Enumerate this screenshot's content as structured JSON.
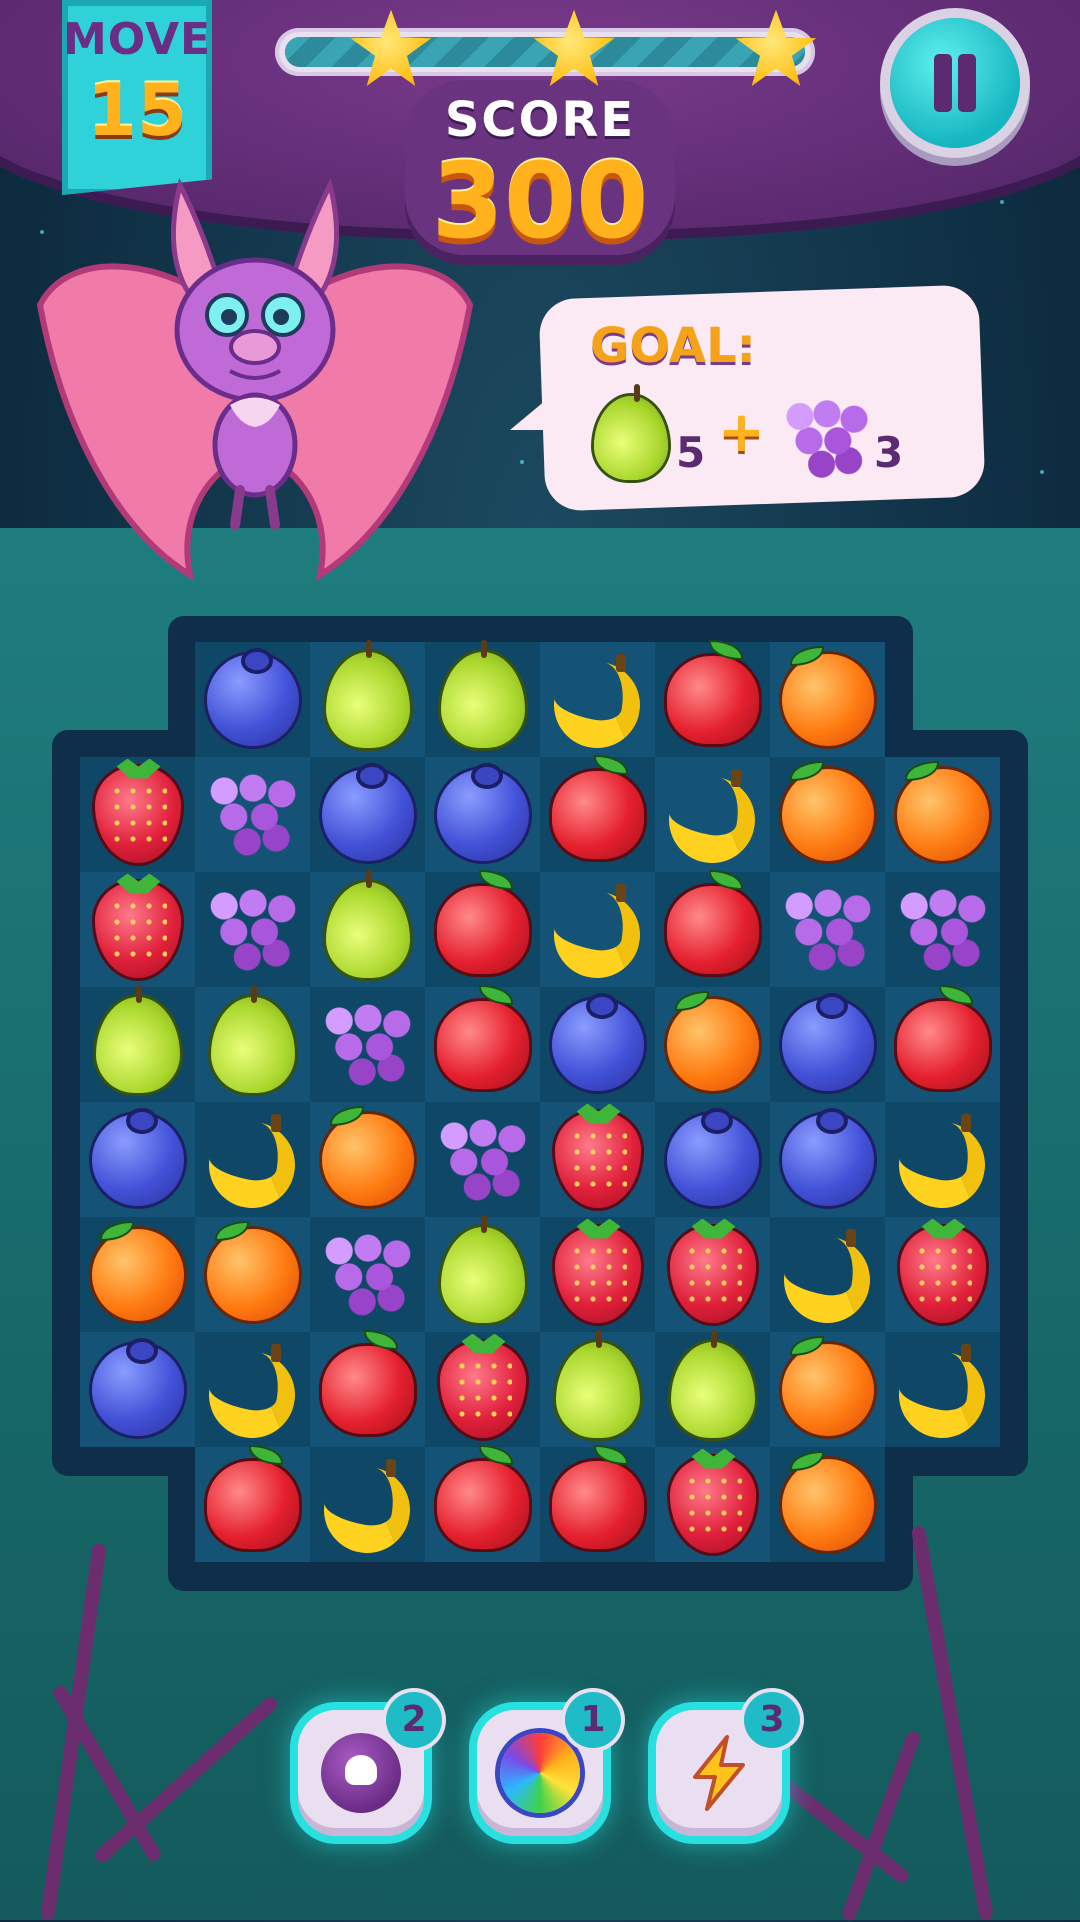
{
  "hud": {
    "move_label": "MOVE",
    "move_value": "15",
    "score_label": "SCORE",
    "score_value": "300",
    "progress_fraction": 1.0,
    "stars_earned": 3
  },
  "goal": {
    "label": "GOAL:",
    "items": [
      {
        "icon": "pear-icon",
        "count": "5"
      },
      {
        "icon": "grape-icon",
        "count": "3"
      }
    ],
    "separator": "+"
  },
  "board": {
    "rows": [
      [
        null,
        "blueberry",
        "pear",
        "pear",
        "banana",
        "apple",
        "orange",
        null
      ],
      [
        "strawberry",
        "grape",
        "blueberry",
        "blueberry",
        "apple",
        "banana",
        "orange",
        "orange"
      ],
      [
        "strawberry",
        "grape",
        "pear",
        "apple",
        "banana",
        "apple",
        "grape",
        "grape"
      ],
      [
        "pear",
        "pear",
        "grape",
        "apple",
        "blueberry",
        "orange",
        "blueberry",
        "apple"
      ],
      [
        "blueberry",
        "banana",
        "orange",
        "grape",
        "strawberry",
        "blueberry",
        "blueberry",
        "banana"
      ],
      [
        "orange",
        "orange",
        "grape",
        "pear",
        "strawberry",
        "strawberry",
        "banana",
        "strawberry"
      ],
      [
        "blueberry",
        "banana",
        "apple",
        "strawberry",
        "pear",
        "pear",
        "orange",
        "banana"
      ],
      [
        null,
        "apple",
        "banana",
        "apple",
        "apple",
        "strawberry",
        "orange",
        null
      ]
    ]
  },
  "boosters": [
    {
      "name": "bomb-skull-icon",
      "count": "2",
      "color": "#7a3a8c"
    },
    {
      "name": "rainbow-potion-icon",
      "count": "1",
      "color": "#4a7ad8"
    },
    {
      "name": "lightning-icon",
      "count": "3",
      "color": "#ffb21b"
    }
  ],
  "colors": {
    "accent_teal": "#28e0e0",
    "score_orange": "#ffb21b",
    "rock_purple": "#6a3380"
  }
}
